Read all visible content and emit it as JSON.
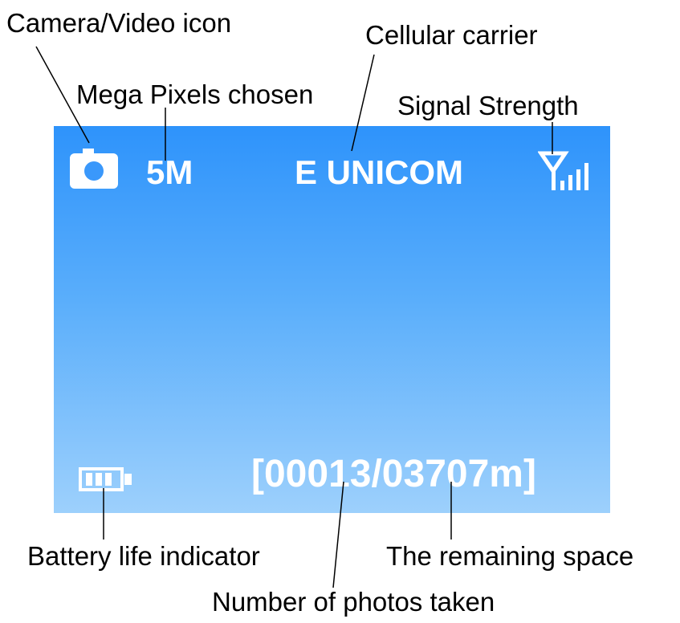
{
  "callouts": {
    "camera_video_icon": "Camera/Video icon",
    "cellular_carrier": "Cellular carrier",
    "mega_pixels": "Mega Pixels chosen",
    "signal_strength": "Signal Strength",
    "battery_life": "Battery life indicator",
    "remaining_space": "The remaining space",
    "photos_taken": "Number of photos taken"
  },
  "screen": {
    "resolution": "5M",
    "carrier": "E UNICOM",
    "counter": "[00013/03707m]",
    "signal_bars": 4,
    "battery_bars": 3
  },
  "icons": {
    "mode": "camera-icon",
    "signal": "signal-strength-icon",
    "battery": "battery-icon"
  },
  "colors": {
    "screen_top": "#2e93fb",
    "screen_bottom": "#9dd0fc",
    "screen_text": "#ffffff",
    "callout_text": "#000000"
  }
}
